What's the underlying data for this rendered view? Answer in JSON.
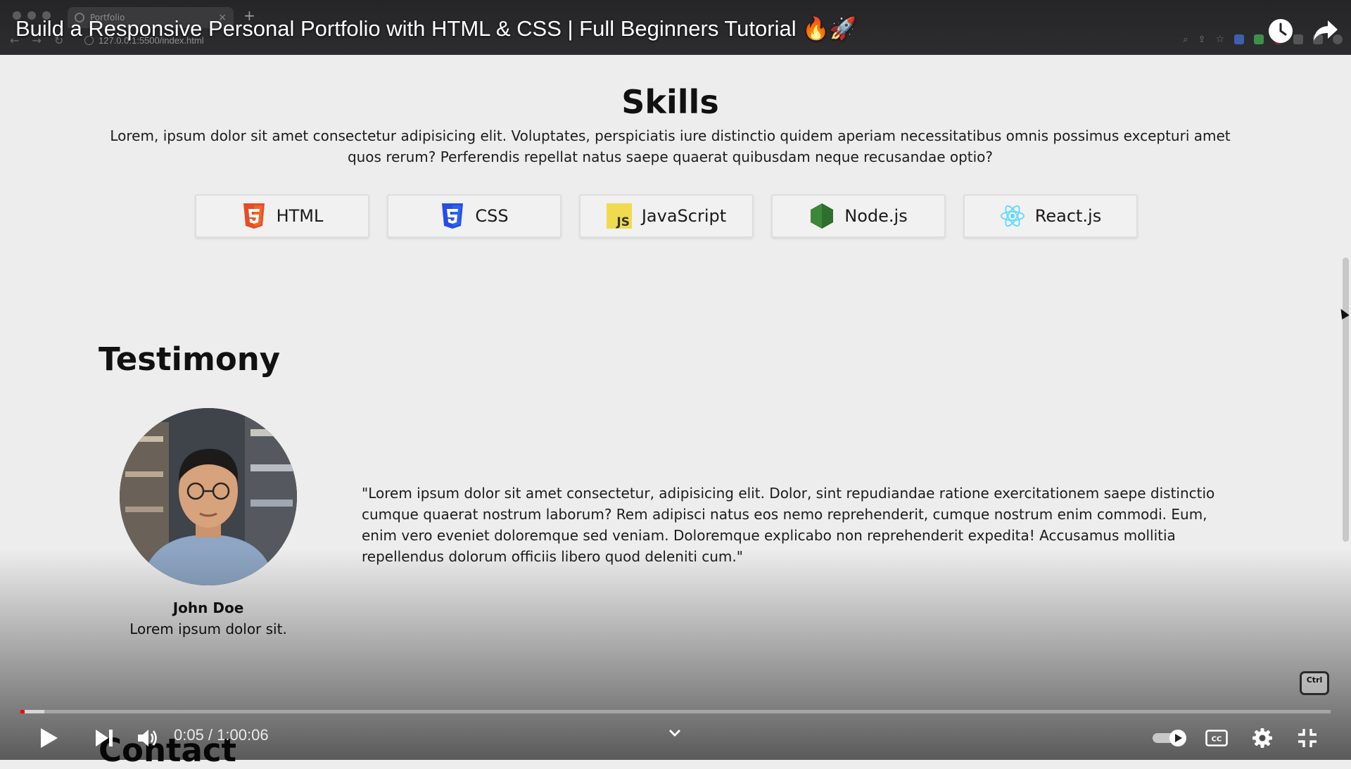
{
  "browser": {
    "tab_title": "Portfolio",
    "url": "127.0.0.1:5500/index.html"
  },
  "video": {
    "title": "Build a Responsive Personal Portfolio with HTML & CSS | Full Beginners Tutorial 🔥🚀",
    "time_current": "0:05",
    "time_total": "1:00:06",
    "time_display": "0:05 / 1:00:06",
    "progress_played_fraction": 0.003,
    "progress_loaded_fraction": 0.018,
    "shortcut_badge": "Ctrl",
    "accent_color": "#ff0000"
  },
  "skills": {
    "title": "Skills",
    "description": "Lorem, ipsum dolor sit amet consectetur adipisicing elit. Voluptates, perspiciatis iure distinctio quidem aperiam necessitatibus omnis possimus excepturi amet quos rerum? Perferendis repellat natus saepe quaerat quibusdam neque recusandae optio?",
    "items": [
      {
        "label": "HTML",
        "icon": "html5-icon",
        "color": "#e44d26"
      },
      {
        "label": "CSS",
        "icon": "css3-icon",
        "color": "#264de4"
      },
      {
        "label": "JavaScript",
        "icon": "javascript-icon",
        "color": "#f0db4f"
      },
      {
        "label": "Node.js",
        "icon": "nodejs-icon",
        "color": "#3c873a"
      },
      {
        "label": "React.js",
        "icon": "react-icon",
        "color": "#61dafb"
      }
    ]
  },
  "testimony": {
    "title": "Testimony",
    "quote": "\"Lorem ipsum dolor sit amet consectetur, adipisicing elit. Dolor, sint repudiandae ratione exercitationem saepe distinctio cumque quaerat nostrum laborum? Rem adipisci natus eos nemo reprehenderit, cumque nostrum enim commodi. Eum, enim vero eveniet doloremque sed veniam. Doloremque explicabo non reprehenderit expedita! Accusamus mollitia repellendus dolorum officiis libero quod deleniti cum.\"",
    "name": "John Doe",
    "role": "Lorem ipsum dolor sit."
  },
  "contact": {
    "title": "Contact"
  }
}
